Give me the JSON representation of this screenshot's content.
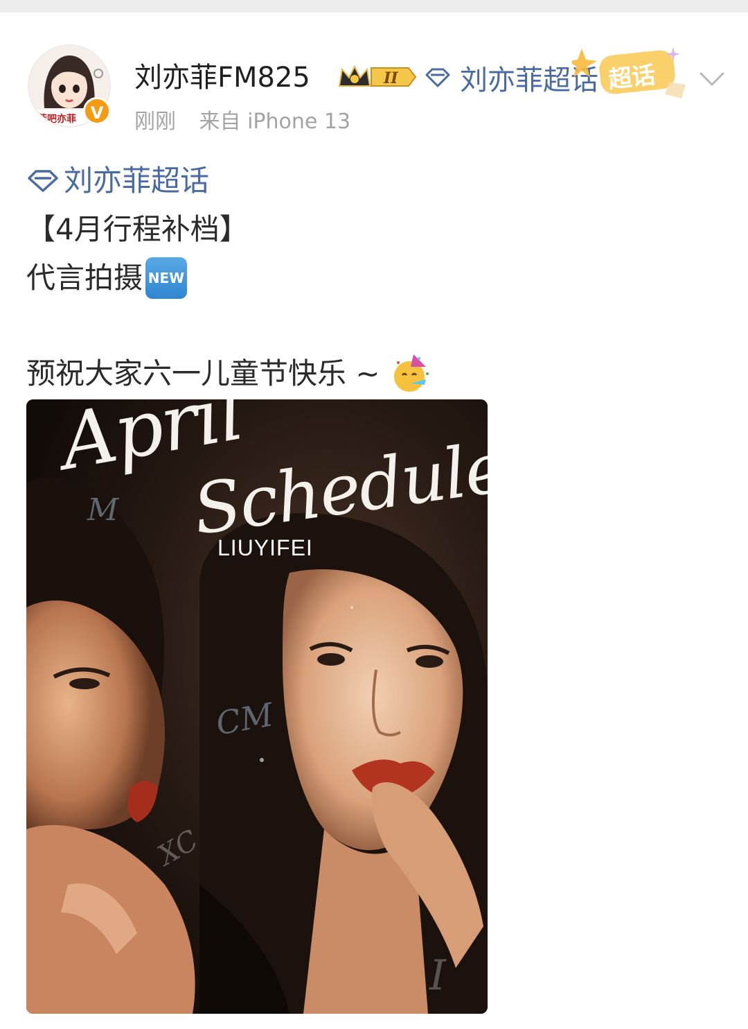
{
  "post": {
    "author": {
      "name": "刘亦菲FM825",
      "avatar_label": "菲吧亦菲",
      "verified_badge": "V",
      "rank_badge": "II",
      "avatar_icon": "cartoon-girl-avatar",
      "crown_icon": "crown-icon"
    },
    "supertopic_link": "刘亦菲超话",
    "supertopic_sticker": "超话",
    "meta": {
      "time": "刚刚",
      "source": "来自 iPhone 13"
    },
    "body": {
      "topic_tag": "刘亦菲超话",
      "line_2": "【4月行程补档】",
      "line_3": "代言拍摄",
      "new_badge": "NEW",
      "line_5": "预祝大家六一儿童节快乐 ~",
      "emoji": "party-face-emoji"
    },
    "image": {
      "title_line_1": "April",
      "title_line_2": "Schedule",
      "name": "LIUYIFEI",
      "mark_m": "M",
      "mark_cm": "CM",
      "mark_xc": "XC",
      "mark_i": "I"
    }
  },
  "colors": {
    "link_blue": "#4a6aa3",
    "meta_gray": "#a3a3a3",
    "verified_orange": "#f59b11",
    "text_dark": "#2b2b2b"
  }
}
